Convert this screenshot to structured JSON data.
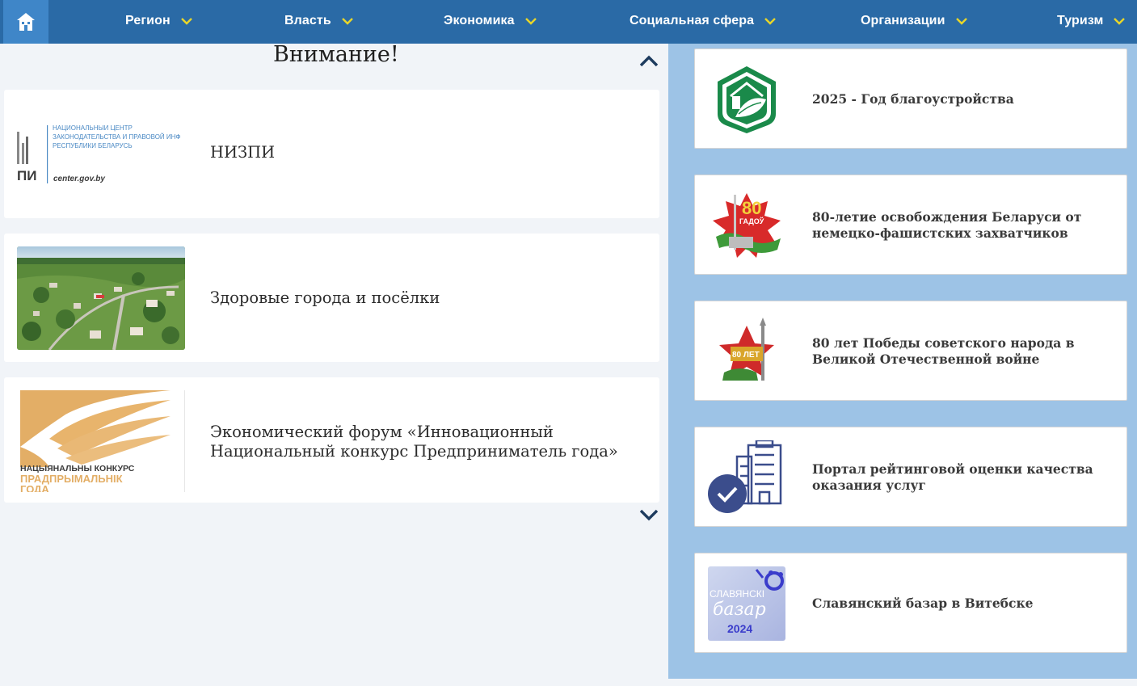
{
  "nav": {
    "home_icon": "home-icon",
    "items": [
      {
        "label": "Регион"
      },
      {
        "label": "Власть"
      },
      {
        "label": "Экономика"
      },
      {
        "label": "Социальная сфера"
      },
      {
        "label": "Организации"
      },
      {
        "label": "Туризм"
      }
    ],
    "bg_color": "#2a6aa6",
    "chevron_color": "#e8d629"
  },
  "attention": {
    "heading": "Внимание!",
    "items": [
      {
        "title": "НИЗПИ",
        "logo_lines": [
          "НАЦИОНАЛЬНЫЙ ЦЕНТР",
          "ЗАКОНОДАТЕЛЬСТВА И ПРАВОВОЙ ИНФ",
          "РЕСПУБЛИКИ БЕЛАРУСЬ"
        ],
        "logo_mark": "ПИ",
        "logo_site": "center.gov.by"
      },
      {
        "title": "Здоровые города и посёлки"
      },
      {
        "title_line1": "Экономический форум «Инновационный",
        "title_line2": "Национальный конкурс Предприниматель года»",
        "logo_line1": "НАЦЫЯНАЛЬНЫ КОНКУРС",
        "logo_line2": "ПРАДПРЫМАЛЬНІК",
        "logo_line3": "ГОДА"
      }
    ]
  },
  "sidebar": {
    "items": [
      {
        "title": "2025 - Год благоустройства",
        "icon": "house-leaf-emblem-icon"
      },
      {
        "title_line1": "80-летие освобождения Беларуси от",
        "title_line2": "немецко-фашистских захватчиков",
        "icon": "80-years-liberation-emblem-icon",
        "emblem_num": "80",
        "emblem_text": "ГАДОЎ"
      },
      {
        "title_line1": "80 лет Победы советского народа в",
        "title_line2": "Великой Отечественной войне",
        "icon": "victory-star-emblem-icon",
        "emblem_text": "80 ЛЕТ"
      },
      {
        "title_line1": "Портал рейтинговой оценки качества",
        "title_line2": "оказания услуг",
        "icon": "building-check-icon"
      },
      {
        "title": "Славянский базар в Витебске",
        "icon": "slavianski-bazaar-logo-icon",
        "logo_line1": "СЛАВЯНСКІ",
        "logo_line2": "базар",
        "logo_line3": "2024"
      }
    ]
  }
}
